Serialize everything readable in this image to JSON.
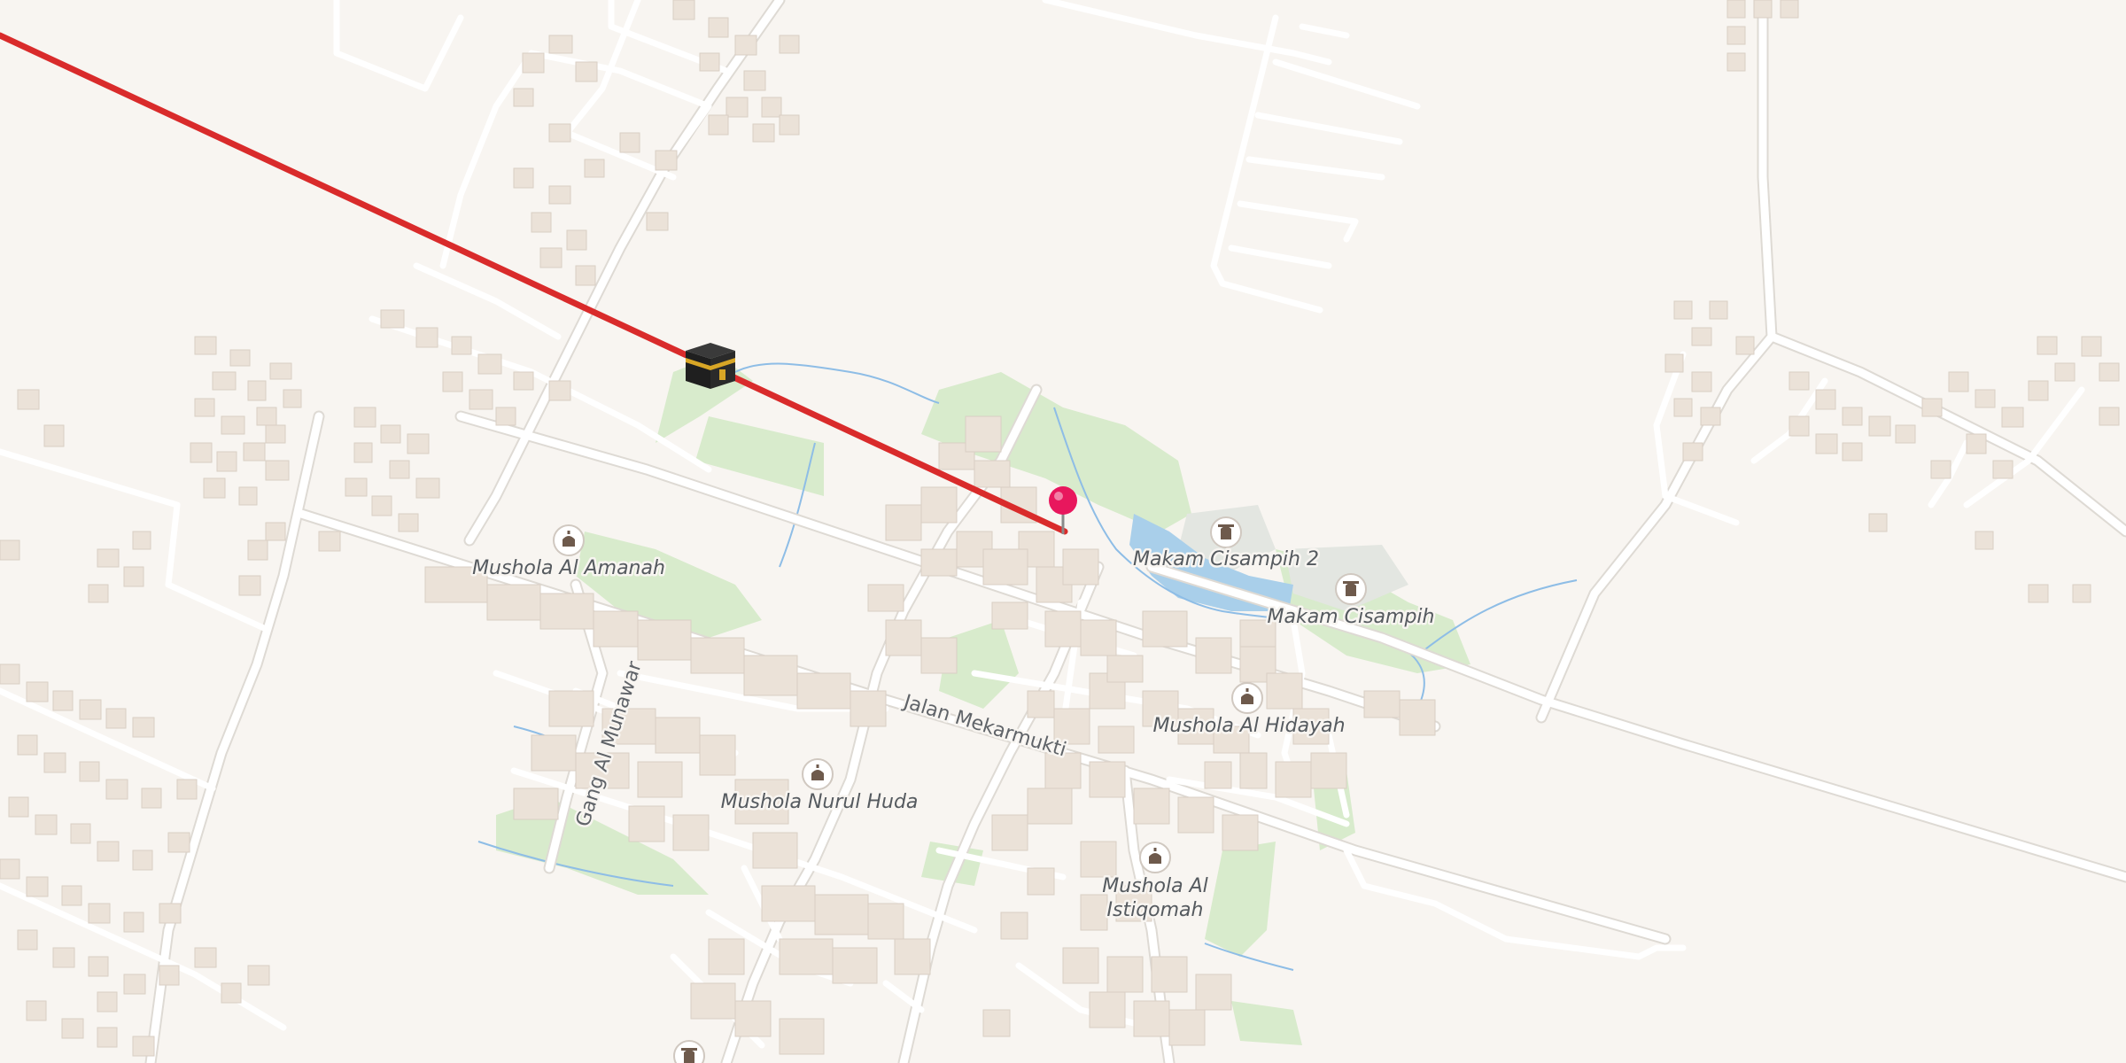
{
  "colors": {
    "background": "#f8f5f1",
    "road": "#ffffff",
    "road_casing": "#dedad4",
    "building": "#ebe2d8",
    "building_stroke": "#d9cfc4",
    "park": "#d8ebcc",
    "cemetery": "#e3e6e1",
    "water": "#a9cfea",
    "stream": "#8ebde6",
    "route_line": "#d92b2b",
    "pin": "#e8175d",
    "poi_icon": "#6e5a4c"
  },
  "route": {
    "from_icon": "kaaba-icon",
    "to_icon": "location-pin-icon"
  },
  "pois": [
    {
      "label": "Mushola Al Amanah",
      "icon": "mosque-icon"
    },
    {
      "label": "Makam Cisampih 2",
      "icon": "cemetery-icon"
    },
    {
      "label": "Makam Cisampih",
      "icon": "cemetery-icon"
    },
    {
      "label": "Mushola Al Hidayah",
      "icon": "mosque-icon"
    },
    {
      "label": "Mushola Nurul Huda",
      "icon": "mosque-icon"
    },
    {
      "label_line1": "Mushola Al",
      "label_line2": "Istiqomah",
      "icon": "mosque-icon"
    },
    {
      "label": "",
      "icon": "cemetery-icon"
    }
  ],
  "streets": [
    "Jalan Mekarmukti",
    "Gang Al Munawar"
  ]
}
